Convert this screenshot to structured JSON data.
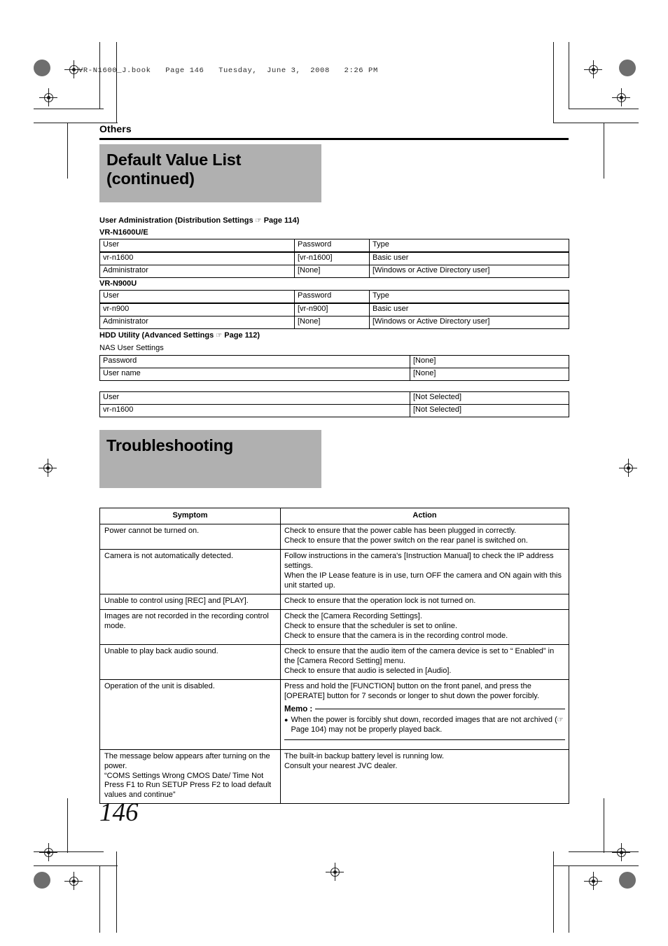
{
  "file_header": "VR-N1600_J.book   Page 146   Tuesday,  June 3,  2008   2:26 PM",
  "chapter": "Others",
  "title": {
    "line1": "Default Value List",
    "line2": "(continued)"
  },
  "page_number": "146",
  "icons": {
    "hand_pointer": "☞"
  },
  "colors": {
    "banner_gray": "#b0b0b0",
    "rule_black": "#000000"
  },
  "user_admin": {
    "heading_pre": "User Administration (Distribution Settings",
    "heading_post": "Page 114)",
    "model_1": "VR-N1600U/E",
    "model_2": "VR-N900U",
    "columns": [
      "User",
      "Password",
      "Type"
    ],
    "table_1": [
      [
        "vr-n1600",
        "[vr-n1600]",
        "Basic user"
      ],
      [
        "Administrator",
        "[None]",
        "[Windows or Active Directory user]"
      ]
    ],
    "table_2": [
      [
        "vr-n900",
        "[vr-n900]",
        "Basic user"
      ],
      [
        "Administrator",
        "[None]",
        "[Windows or Active Directory user]"
      ]
    ]
  },
  "hdd_utility": {
    "heading_pre": "HDD Utility (Advanced Settings",
    "heading_post": "Page 112)",
    "subheading": "NAS User Settings",
    "table_1": [
      [
        "Password",
        "[None]"
      ],
      [
        "User name",
        "[None]"
      ]
    ],
    "table_2": [
      [
        "User",
        "[Not Selected]"
      ],
      [
        "vr-n1600",
        "[Not Selected]"
      ]
    ]
  },
  "troubleshooting": {
    "title": "Troubleshooting",
    "columns": [
      "Symptom",
      "Action"
    ],
    "rows": [
      {
        "symptom": [
          "Power cannot be turned on."
        ],
        "action": [
          "Check to ensure that the power cable has been plugged in correctly.",
          "Check to ensure that the power switch on the rear panel is switched on."
        ]
      },
      {
        "symptom": [
          "Camera is not automatically detected."
        ],
        "action": [
          "Follow instructions in the camera's [Instruction Manual] to check the IP address settings.",
          "When the IP Lease feature is in use, turn OFF the camera and ON again with this unit started up."
        ]
      },
      {
        "symptom": [
          " Unable to control using [REC] and [PLAY]."
        ],
        "action": [
          "Check to ensure that the operation lock is not turned on."
        ]
      },
      {
        "symptom": [
          "Images are not recorded in the recording control mode."
        ],
        "action": [
          "Check the [Camera Recording Settings].",
          "Check to ensure that the scheduler is set to online.",
          "Check to ensure that the camera is in the recording control mode."
        ]
      },
      {
        "symptom": [
          "Unable to play back audio sound."
        ],
        "action": [
          "Check to ensure that the audio item of the camera device is set to “ Enabled” in the [Camera Record Setting] menu.",
          "Check to ensure that audio is selected in [Audio]."
        ]
      },
      {
        "symptom": [
          "Operation of the unit is disabled."
        ],
        "action": [
          "Press and hold the [FUNCTION] button on the front panel, and press the [OPERATE] button for 7 seconds or longer to shut down the power forcibly."
        ],
        "memo": {
          "label": "Memo :",
          "items_pre": "When the power is forcibly shut down, recorded images that are not archived (",
          "items_link": "Page 104",
          "items_post": ") may not be properly played back."
        }
      },
      {
        "symptom": [
          "The message below appears after turning on the power.",
          "“COMS Settings Wrong CMOS Date/ Time Not Press F1 to Run SETUP Press F2 to load default values and continue”"
        ],
        "action": [
          "The built-in backup battery level is running low.",
          "Consult your nearest JVC dealer."
        ]
      }
    ]
  }
}
